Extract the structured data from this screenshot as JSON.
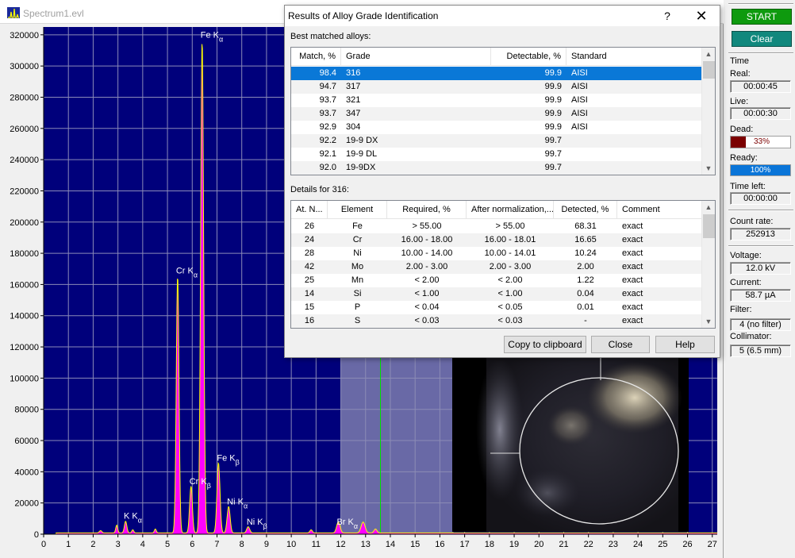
{
  "main_window": {
    "title": "Spectrum1.evl"
  },
  "chart_data": {
    "type": "line",
    "xlim": [
      0,
      27.2
    ],
    "ylim": [
      0,
      325000
    ],
    "x_ticks": [
      0,
      1,
      2,
      3,
      4,
      5,
      6,
      7,
      8,
      9,
      10,
      11,
      12,
      13,
      14,
      15,
      16,
      17,
      18,
      19,
      20,
      21,
      22,
      23,
      24,
      25,
      26,
      27
    ],
    "y_ticks": [
      0,
      20000,
      40000,
      60000,
      80000,
      100000,
      120000,
      140000,
      160000,
      180000,
      200000,
      220000,
      240000,
      260000,
      280000,
      300000,
      320000
    ],
    "grid": true,
    "background": "#00007b",
    "fill_color": "#ff00ff",
    "line_color": "#ffff00",
    "selection_region": [
      12.0,
      16.55
    ],
    "cursor_x": 13.6,
    "peaks": [
      {
        "x": 2.3,
        "y": 1500,
        "w": 0.05
      },
      {
        "x": 2.95,
        "y": 5000,
        "w": 0.04
      },
      {
        "x": 3.31,
        "y": 7500,
        "w": 0.05
      },
      {
        "x": 3.6,
        "y": 2000,
        "w": 0.04
      },
      {
        "x": 4.51,
        "y": 2500,
        "w": 0.04
      },
      {
        "x": 5.41,
        "y": 165000,
        "w": 0.055
      },
      {
        "x": 5.95,
        "y": 30000,
        "w": 0.055
      },
      {
        "x": 6.4,
        "y": 316000,
        "w": 0.06
      },
      {
        "x": 7.06,
        "y": 45000,
        "w": 0.06
      },
      {
        "x": 7.47,
        "y": 17000,
        "w": 0.06
      },
      {
        "x": 8.26,
        "y": 4000,
        "w": 0.06
      },
      {
        "x": 10.8,
        "y": 2000,
        "w": 0.05
      },
      {
        "x": 11.9,
        "y": 7000,
        "w": 0.07
      },
      {
        "x": 12.9,
        "y": 7000,
        "w": 0.08
      },
      {
        "x": 13.4,
        "y": 2500,
        "w": 0.06
      }
    ],
    "background_level": 800,
    "peak_labels": [
      {
        "element": "K",
        "line": "α",
        "x": 3.3,
        "y": 8000
      },
      {
        "element": "Cr",
        "line": "α",
        "x": 5.41,
        "y": 165000
      },
      {
        "element": "Fe",
        "line": "α",
        "x": 6.4,
        "y": 316000
      },
      {
        "element": "Cr",
        "line": "β",
        "x": 5.95,
        "y": 30000
      },
      {
        "element": "Fe",
        "line": "β",
        "x": 7.06,
        "y": 45000
      },
      {
        "element": "Ni",
        "line": "α",
        "x": 7.47,
        "y": 17000
      },
      {
        "element": "Ni",
        "line": "β",
        "x": 8.26,
        "y": 4000
      },
      {
        "element": "Br",
        "line": "α",
        "x": 11.9,
        "y": 4000
      }
    ]
  },
  "side_panel": {
    "start_label": "START",
    "clear_label": "Clear",
    "time_label": "Time",
    "real_label": "Real:",
    "real_value": "00:00:45",
    "live_label": "Live:",
    "live_value": "00:00:30",
    "dead_label": "Dead:",
    "dead_value": "33%",
    "dead_fraction": 0.33,
    "ready_label": "Ready:",
    "ready_value": "100%",
    "ready_fraction": 1.0,
    "time_left_label": "Time left:",
    "time_left_value": "00:00:00",
    "count_rate_label": "Count rate:",
    "count_rate_value": "252913",
    "voltage_label": "Voltage:",
    "voltage_value": "12.0 kV",
    "current_label": "Current:",
    "current_value": "58.7 µA",
    "filter_label": "Filter:",
    "filter_value": "4 (no filter)",
    "collimator_label": "Collimator:",
    "collimator_value": "5 (6.5 mm)"
  },
  "dialog": {
    "title": "Results of Alloy Grade Identification",
    "help_glyph": "?",
    "close_glyph": "✕",
    "best_label": "Best matched alloys:",
    "best_columns": [
      "Match, %",
      "Grade",
      "Detectable, %",
      "Standard"
    ],
    "best_rows": [
      [
        "98.4",
        "316",
        "99.9",
        "AISI"
      ],
      [
        "94.7",
        "317",
        "99.9",
        "AISI"
      ],
      [
        "93.7",
        "321",
        "99.9",
        "AISI"
      ],
      [
        "93.7",
        "347",
        "99.9",
        "AISI"
      ],
      [
        "92.9",
        "304",
        "99.9",
        "AISI"
      ],
      [
        "92.2",
        "19-9 DX",
        "99.7",
        ""
      ],
      [
        "92.1",
        "19-9 DL",
        "99.7",
        ""
      ],
      [
        "92.0",
        "19-9DX",
        "99.7",
        ""
      ]
    ],
    "selected_row": 0,
    "details_label": "Details for 316:",
    "detail_columns": [
      "At. N...",
      "Element",
      "Required, %",
      "After normalization,...",
      "Detected, %",
      "Comment"
    ],
    "detail_rows": [
      [
        "26",
        "Fe",
        "> 55.00",
        "> 55.00",
        "68.31",
        "exact"
      ],
      [
        "24",
        "Cr",
        "16.00 - 18.00",
        "16.00 - 18.01",
        "16.65",
        "exact"
      ],
      [
        "28",
        "Ni",
        "10.00 - 14.00",
        "10.00 - 14.01",
        "10.24",
        "exact"
      ],
      [
        "42",
        "Mo",
        "2.00 - 3.00",
        "2.00 - 3.00",
        "2.00",
        "exact"
      ],
      [
        "25",
        "Mn",
        "< 2.00",
        "< 2.00",
        "1.22",
        "exact"
      ],
      [
        "14",
        "Si",
        "< 1.00",
        "< 1.00",
        "0.04",
        "exact"
      ],
      [
        "15",
        "P",
        "< 0.04",
        "< 0.05",
        "0.01",
        "exact"
      ],
      [
        "16",
        "S",
        "< 0.03",
        "< 0.03",
        "-",
        "exact"
      ]
    ],
    "copy_label": "Copy to clipboard",
    "close_label": "Close",
    "help_label": "Help"
  }
}
